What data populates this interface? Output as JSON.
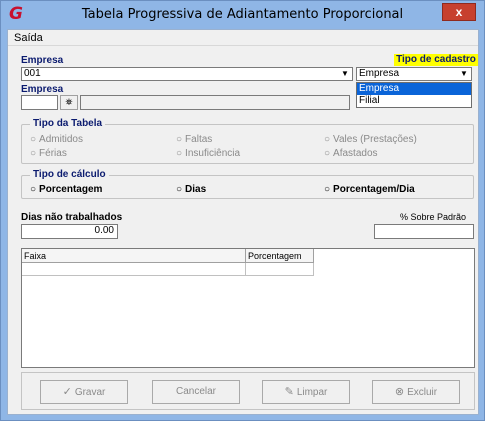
{
  "window": {
    "title": "Tabela Progressiva de Adiantamento Proporcional",
    "close_label": "x"
  },
  "menu": {
    "saida": "Saída"
  },
  "empresa_label": "Empresa",
  "empresa_combo_value": "001",
  "tipo_cadastro": {
    "label": "Tipo de cadastro",
    "selected": "Empresa",
    "options": [
      "Empresa",
      "Filial"
    ]
  },
  "empresa2_label": "Empresa",
  "tipo_tabela": {
    "title": "Tipo da Tabela",
    "options": [
      "Admitidos",
      "Faltas",
      "Vales (Prestações)",
      "Férias",
      "Insuficiência",
      "Afastados"
    ]
  },
  "tipo_calculo": {
    "title": "Tipo de cálculo",
    "options": [
      "Porcentagem",
      "Dias",
      "Porcentagem/Dia"
    ]
  },
  "dias_nao_trabalhados": {
    "label": "Dias não trabalhados",
    "value": "0.00"
  },
  "sobre_padrao": {
    "label": "% Sobre Padrão",
    "value": ""
  },
  "table": {
    "columns": [
      "Faixa",
      "Porcentagem"
    ]
  },
  "buttons": {
    "gravar": "Gravar",
    "cancelar": "Cancelar",
    "limpar": "Limpar",
    "excluir": "Excluir"
  },
  "colors": {
    "titlebar": "#8fb6e6",
    "close": "#c7402e",
    "label_blue": "#0b1b6f",
    "highlight": "#ffff00",
    "selection": "#0a64d8"
  }
}
